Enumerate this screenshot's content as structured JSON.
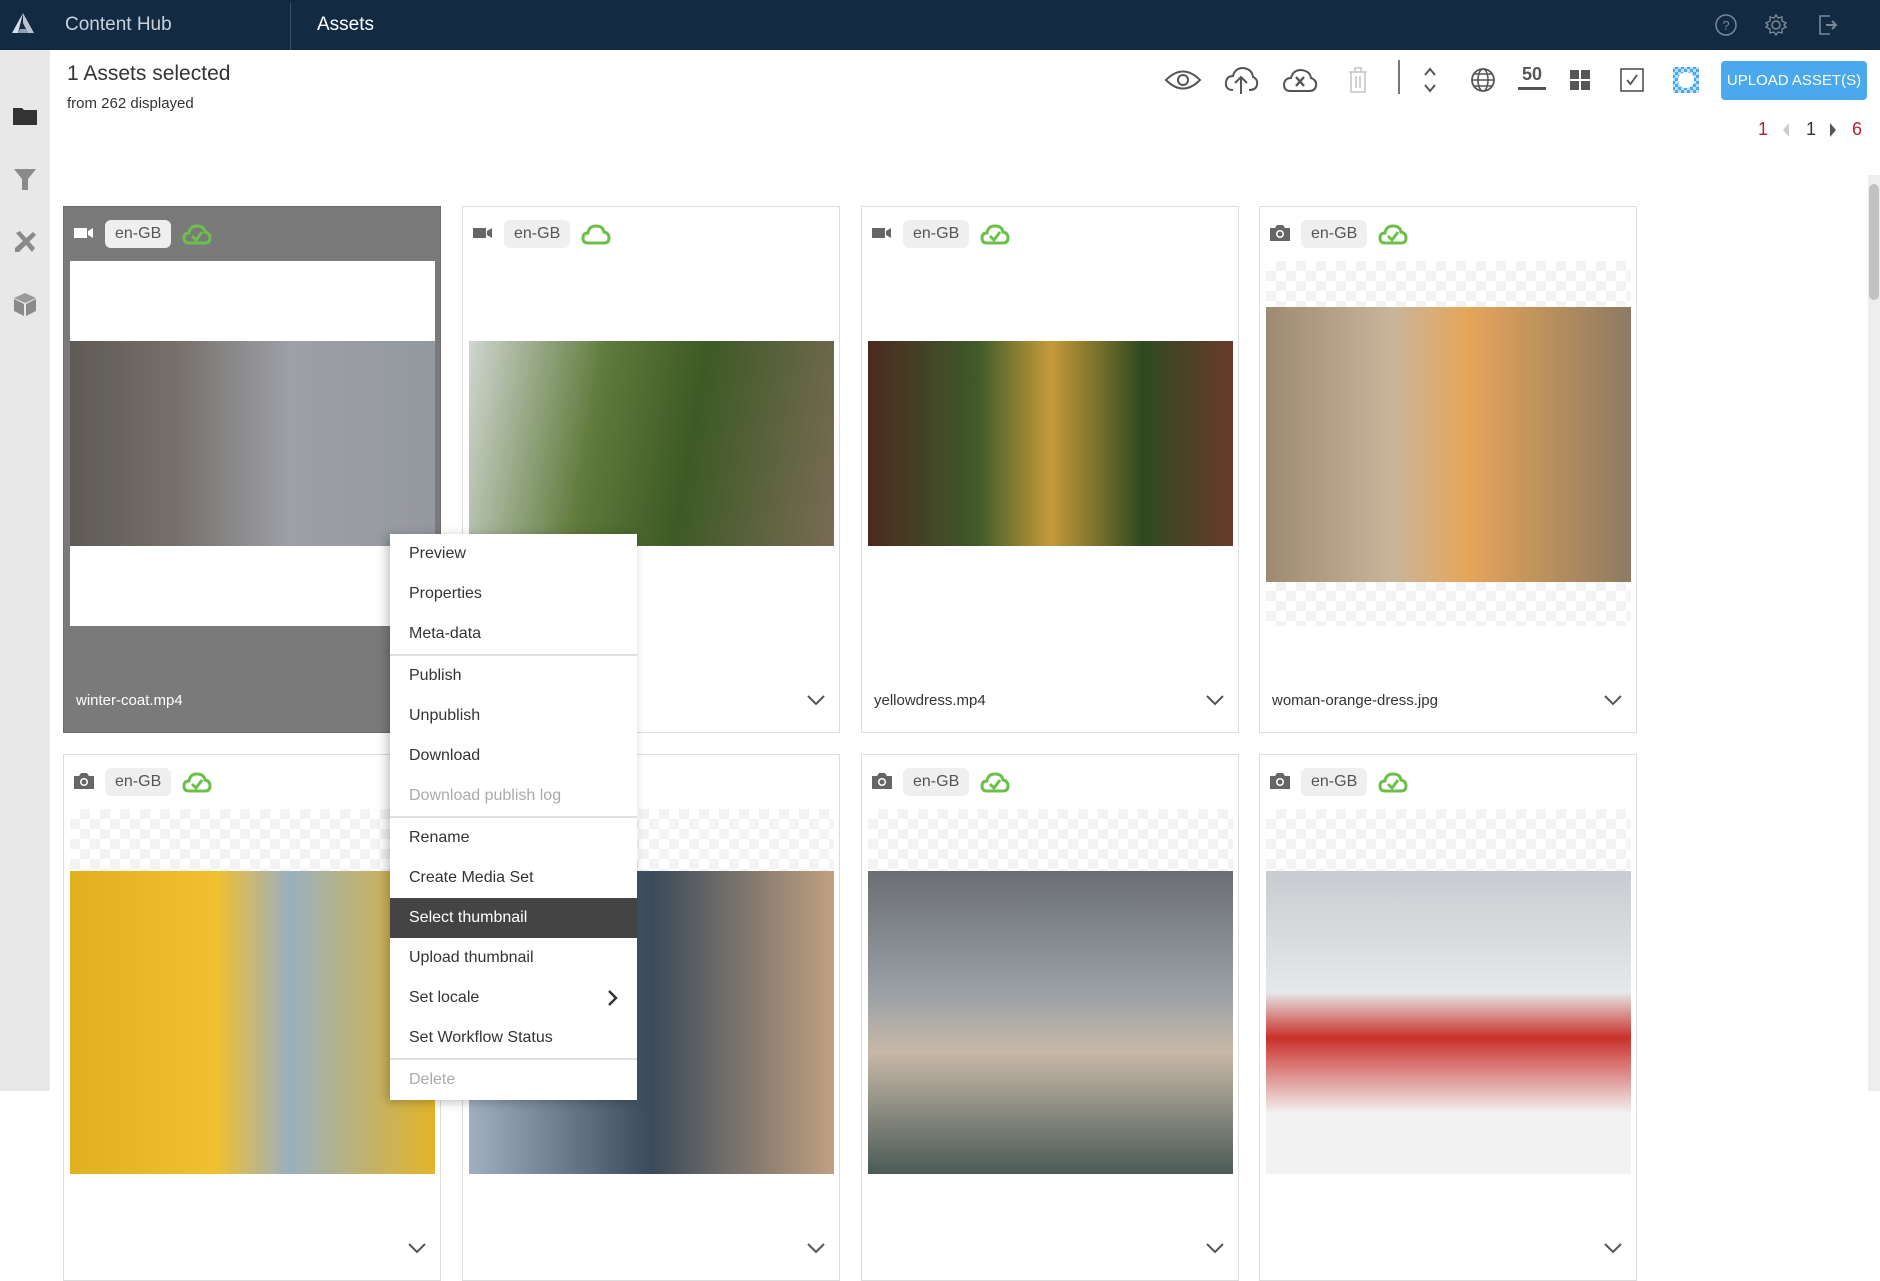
{
  "header": {
    "app_name": "Content Hub",
    "section": "Assets",
    "icons": [
      "help-icon",
      "settings-icon",
      "logout-icon"
    ]
  },
  "sidebar": {
    "items": [
      {
        "icon": "folder-icon",
        "label": "Folders"
      },
      {
        "icon": "filter-icon",
        "label": "Filter"
      },
      {
        "icon": "tools-icon",
        "label": "Tools"
      },
      {
        "icon": "box-icon",
        "label": "Packages"
      }
    ]
  },
  "selection": {
    "title": "1 Assets selected",
    "subtitle": "from 262 displayed"
  },
  "toolbar": {
    "icons": [
      "preview-icon",
      "publish-icon",
      "unpublish-icon",
      "delete-icon",
      "sort-icon",
      "locale-icon",
      "page-size",
      "grid-view-icon",
      "select-all-icon",
      "transparency-icon"
    ],
    "page_size": "50",
    "upload_label": "UPLOAD ASSET(S)",
    "accent": "#4aa8ec"
  },
  "pagination": {
    "first": "1",
    "current": "1",
    "last": "6"
  },
  "assets": [
    {
      "type": "video",
      "locale": "en-GB",
      "status": "published",
      "filename": "winter-coat.mp4",
      "selected": true
    },
    {
      "type": "video",
      "locale": "en-GB",
      "status": "unpublished",
      "filename": "",
      "selected": false
    },
    {
      "type": "video",
      "locale": "en-GB",
      "status": "published",
      "filename": "yellowdress.mp4",
      "selected": false
    },
    {
      "type": "image",
      "locale": "en-GB",
      "status": "published",
      "filename": "woman-orange-dress.jpg",
      "selected": false
    },
    {
      "type": "image",
      "locale": "en-GB",
      "status": "published",
      "filename": "",
      "selected": false
    },
    {
      "type": "image",
      "locale": "en-GB",
      "status": "published",
      "filename": "",
      "selected": false
    },
    {
      "type": "image",
      "locale": "en-GB",
      "status": "published",
      "filename": "",
      "selected": false
    },
    {
      "type": "image",
      "locale": "en-GB",
      "status": "published",
      "filename": "",
      "selected": false
    }
  ],
  "context_menu": {
    "groups": [
      [
        {
          "label": "Preview"
        },
        {
          "label": "Properties"
        },
        {
          "label": "Meta-data"
        }
      ],
      [
        {
          "label": "Publish"
        },
        {
          "label": "Unpublish"
        },
        {
          "label": "Download"
        },
        {
          "label": "Download publish log",
          "disabled": true
        }
      ],
      [
        {
          "label": "Rename"
        },
        {
          "label": "Create Media Set"
        },
        {
          "label": "Select thumbnail",
          "active": true
        },
        {
          "label": "Upload thumbnail"
        },
        {
          "label": "Set locale",
          "submenu": true
        },
        {
          "label": "Set Workflow Status"
        }
      ],
      [
        {
          "label": "Delete",
          "disabled": true
        }
      ]
    ]
  },
  "colors": {
    "header_bg": "#122a42",
    "published_green": "#6cc04a",
    "pager_red": "#b5203a",
    "selected_card": "#7a7a7a"
  }
}
